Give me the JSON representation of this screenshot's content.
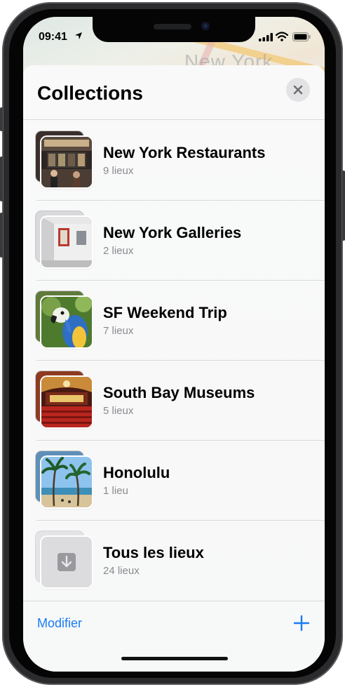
{
  "status_bar": {
    "time": "09:41"
  },
  "map": {
    "label": "New York"
  },
  "sheet": {
    "title": "Collections",
    "items": [
      {
        "title": "New York Restaurants",
        "count": "9 lieux",
        "image": "restaurant-photo"
      },
      {
        "title": "New York Galleries",
        "count": "2 lieux",
        "image": "gallery-photo"
      },
      {
        "title": "SF Weekend Trip",
        "count": "7 lieux",
        "image": "parrot-photo"
      },
      {
        "title": "South Bay Museums",
        "count": "5 lieux",
        "image": "theater-photo"
      },
      {
        "title": "Honolulu",
        "count": "1 lieu",
        "image": "beach-photo"
      },
      {
        "title": "Tous les lieux",
        "count": "24 lieux",
        "image": "download-tray-icon"
      }
    ],
    "footer": {
      "edit_label": "Modifier"
    }
  },
  "colors": {
    "accent": "#1a7cf5",
    "secondary_text": "#8a8a8e",
    "separator": "#dadadc"
  }
}
